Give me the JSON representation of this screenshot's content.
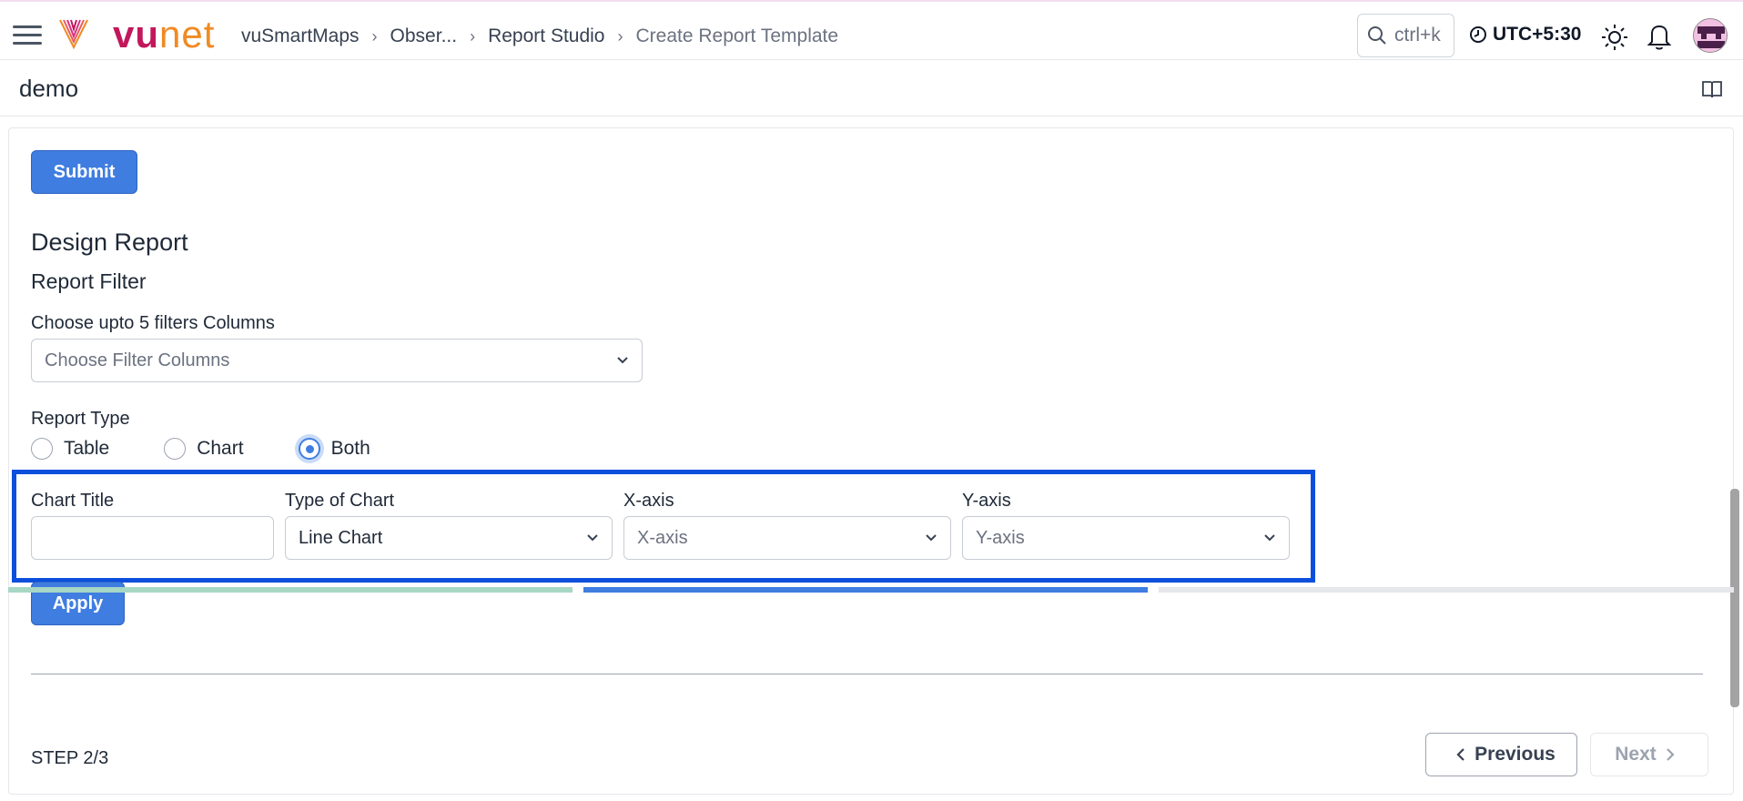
{
  "header": {
    "logo_vu": "vu",
    "logo_net": "net",
    "breadcrumbs": [
      "vuSmartMaps",
      "Obser...",
      "Report Studio",
      "Create Report Template"
    ],
    "search_text": "ctrl+k",
    "timezone": "UTC+5:30"
  },
  "page": {
    "name": "demo"
  },
  "form": {
    "submit_label": "Submit",
    "design_heading": "Design Report",
    "filter_heading": "Report Filter",
    "filter_label": "Choose upto 5 filters Columns",
    "filter_placeholder": "Choose Filter Columns",
    "report_type_label": "Report Type",
    "report_types": [
      "Table",
      "Chart",
      "Both"
    ],
    "report_type_selected": "Both",
    "chart_title_label": "Chart Title",
    "chart_title_value": "",
    "chart_type_label": "Type of Chart",
    "chart_type_value": "Line Chart",
    "xaxis_label": "X-axis",
    "xaxis_placeholder": "X-axis",
    "yaxis_label": "Y-axis",
    "yaxis_placeholder": "Y-axis",
    "apply_label": "Apply"
  },
  "footer": {
    "step_text": "STEP 2/3",
    "previous_label": "Previous",
    "next_label": "Next",
    "progress_colors": [
      "#a7d7c5",
      "#3f7de0",
      "#e5e7eb"
    ]
  },
  "icons": [
    "menu-icon",
    "vunet-logo-icon",
    "search-icon",
    "clock-icon",
    "sun-icon",
    "bell-icon",
    "user-avatar",
    "book-icon",
    "chevron-down-icon",
    "chevron-left-icon",
    "chevron-right-icon"
  ]
}
